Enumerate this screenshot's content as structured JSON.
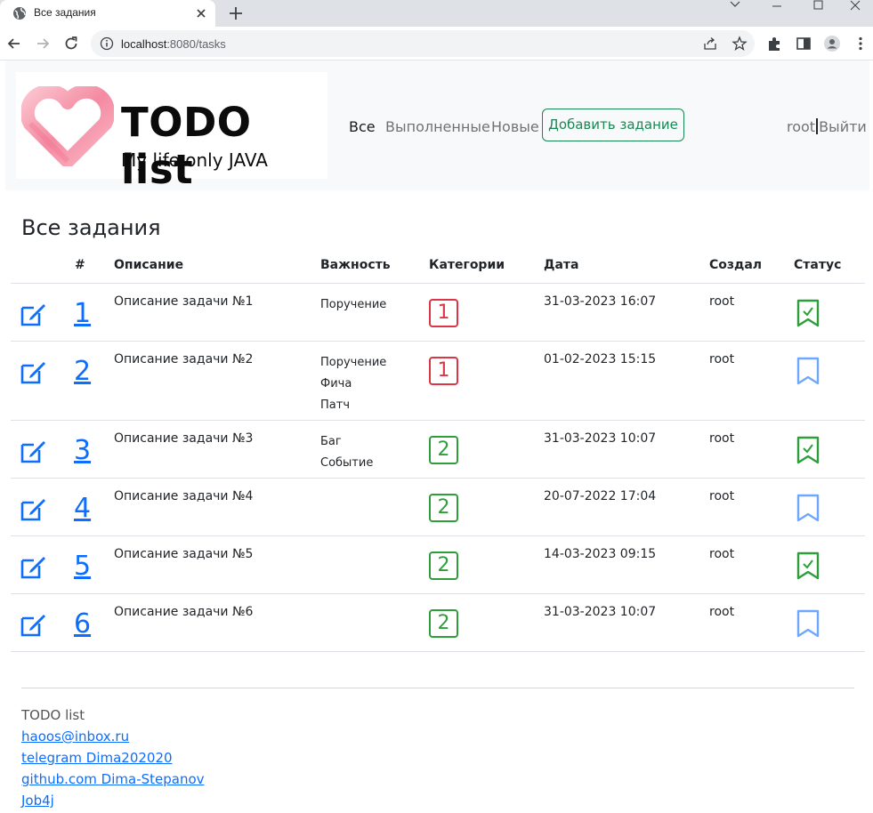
{
  "browser": {
    "tab_title": "Все задания",
    "url_host": "localhost",
    "url_rest": ":8080/tasks"
  },
  "brand": {
    "title": "TODO list",
    "subtitle": "My life only JAVA"
  },
  "nav": {
    "all": "Все",
    "done": "Выполненные",
    "new": "Новые",
    "add_button": "Добавить задание",
    "user": "root",
    "logout": "Выйти"
  },
  "page_title": "Все задания",
  "table": {
    "headers": {
      "num": "#",
      "description": "Описание",
      "priority": "Важность",
      "categories": "Категории",
      "date": "Дата",
      "author": "Создал",
      "status": "Статус"
    },
    "rows": [
      {
        "id": "1",
        "description": "Описание задачи №1",
        "priorities": [
          "Поручение"
        ],
        "categories": "1",
        "date": "31-03-2023 16:07",
        "author": "root",
        "done": true
      },
      {
        "id": "2",
        "description": "Описание задачи №2",
        "priorities": [
          "Поручение",
          "Фича",
          "Патч"
        ],
        "categories": "1",
        "date": "01-02-2023 15:15",
        "author": "root",
        "done": false
      },
      {
        "id": "3",
        "description": "Описание задачи №3",
        "priorities": [
          "Баг",
          "Событие"
        ],
        "categories": "2",
        "date": "31-03-2023 10:07",
        "author": "root",
        "done": true
      },
      {
        "id": "4",
        "description": "Описание задачи №4",
        "priorities": [],
        "categories": "2",
        "date": "20-07-2022 17:04",
        "author": "root",
        "done": false
      },
      {
        "id": "5",
        "description": "Описание задачи №5",
        "priorities": [],
        "categories": "2",
        "date": "14-03-2023 09:15",
        "author": "root",
        "done": true
      },
      {
        "id": "6",
        "description": "Описание задачи №6",
        "priorities": [],
        "categories": "2",
        "date": "31-03-2023 10:07",
        "author": "root",
        "done": false
      }
    ]
  },
  "footer": {
    "name": "TODO list",
    "links": [
      "haoos@inbox.ru",
      "telegram Dima202020",
      "github.com Dima-Stepanov",
      "Job4j"
    ]
  },
  "colors": {
    "primary": "#0d6efd",
    "success": "#198754",
    "danger": "#dc3545",
    "badge_green": "#2e9e3a",
    "bookmark_blue": "#6ea8fe",
    "heart_pink": "#f7a3b5"
  },
  "icons": {
    "edit": "pencil-square-icon",
    "done": "bookmark-check-icon",
    "not_done": "bookmark-icon"
  }
}
